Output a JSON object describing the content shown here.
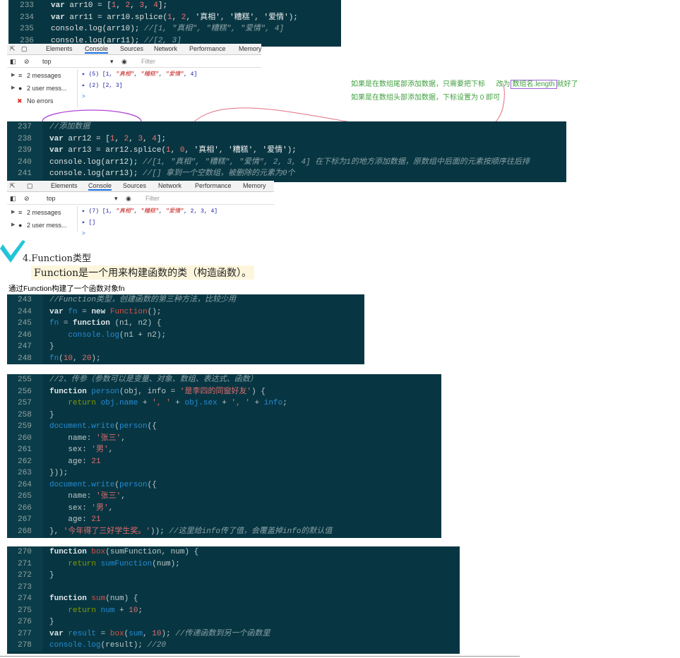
{
  "block1": {
    "lines": [
      {
        "n": "233",
        "html": "<span class='k'>var</span> <span class='p'>arr10 = [</span><span class='n'>1</span><span class='p'>, </span><span class='n'>2</span><span class='p'>, </span><span class='n'>3</span><span class='p'>, </span><span class='n'>4</span><span class='p'>];</span>"
      },
      {
        "n": "234",
        "html": "<span class='k'>var</span> <span class='p'>arr11 = arr10.splice(</span><span class='n'>1</span><span class='p'>, </span><span class='n'>2</span><span class='p'>, </span><span class='s'>'真相'</span><span class='p'>, </span><span class='s'>'糟糕'</span><span class='p'>, </span><span class='s'>'爱情'</span><span class='p'>);</span>"
      },
      {
        "n": "235",
        "html": "<span class='p'>console.log(arr10); </span><span class='c'>//[1, \"真相\", \"糟糕\", \"爱情\", 4]</span>"
      },
      {
        "n": "236",
        "html": "<span class='p'>console.log(arr11); </span><span class='c'>//[2, 3]</span>"
      }
    ]
  },
  "devtools1": {
    "tabs": [
      "Elements",
      "Console",
      "Sources",
      "Network",
      "Performance",
      "Memory"
    ],
    "context": "top",
    "filter_placeholder": "Filter",
    "sidebar": [
      {
        "icon": "≡",
        "label": "2 messages"
      },
      {
        "icon": "●",
        "label": "2 user mess..."
      },
      {
        "icon": "✖",
        "label": "No errors"
      }
    ],
    "output": [
      {
        "prefix": "▸ (5) [1, ",
        "items": [
          "\"真相\"",
          "\"糟糕\"",
          "\"爱情\""
        ],
        "suffix": ", 4]"
      },
      {
        "prefix": "▸ (2) [2, 3]",
        "items": [],
        "suffix": ""
      }
    ],
    "prompt": ">"
  },
  "notes": {
    "line1_a": "如果是在数组尾部添加数据，只需要把下标",
    "line1_b": "改为",
    "line1_box": "数组名.length",
    "line1_c": "就好了",
    "line2": "如果是在数组头部添加数据，下标设置为 0 即可"
  },
  "block2": {
    "lines": [
      {
        "n": "237",
        "html": "<span class='c'>//添加数据</span>"
      },
      {
        "n": "238",
        "html": "<span class='k'>var</span> <span class='p'>arr12 = [</span><span class='n'>1</span><span class='p'>, </span><span class='n'>2</span><span class='p'>, </span><span class='n'>3</span><span class='p'>, </span><span class='n'>4</span><span class='p'>];</span>"
      },
      {
        "n": "239",
        "html": "<span class='k'>var</span> <span class='p'>arr13 = arr12.splice(</span><span class='n'>1</span><span class='p'>, </span><span class='n'>0</span><span class='p'>, </span><span class='s'>'真相'</span><span class='p'>, </span><span class='s'>'糟糕'</span><span class='p'>, </span><span class='s'>'爱情'</span><span class='p'>);</span>"
      },
      {
        "n": "240",
        "html": "<span class='p'>console.log(arr12); </span><span class='c'>//[1, \"真相\", \"糟糕\", \"爱情\", 2, 3, 4] 在下标为1的地方添加数据，原数组中后面的元素按顺序往后排</span>"
      },
      {
        "n": "241",
        "html": "<span class='p'>console.log(arr13); </span><span class='c'>//[] 拿到一个空数组，被删除的元素为0个</span>"
      }
    ]
  },
  "devtools2": {
    "tabs": [
      "Elements",
      "Console",
      "Sources",
      "Network",
      "Performance",
      "Memory"
    ],
    "context": "top",
    "filter_placeholder": "Filter",
    "sidebar": [
      {
        "icon": "≡",
        "label": "2 messages"
      },
      {
        "icon": "●",
        "label": "2 user mess..."
      }
    ],
    "output": [
      {
        "prefix": "▸ (7) [1, ",
        "items": [
          "\"真相\"",
          "\"糟糕\"",
          "\"爱情\""
        ],
        "suffix": ", 2, 3, 4]"
      },
      {
        "prefix": "▸ []",
        "items": [],
        "suffix": ""
      }
    ],
    "prompt": ">"
  },
  "doc": {
    "heading": "4.Function类型",
    "para": "Function是一个用来构建函数的类（构造函数）。",
    "caption": "通过Function构建了一个函数对象fn"
  },
  "block3": {
    "lines": [
      {
        "n": "243",
        "html": "<span class='c'>//Function类型，创建函数的第三种方法，比较少用</span>"
      },
      {
        "n": "244",
        "html": "<span class='kb'>var</span> <span class='f'>fn</span> <span class='pl'>=</span> <span class='kb'>new</span> <span class='fn'>Function</span><span class='pl'>();</span>"
      },
      {
        "n": "245",
        "html": "<span class='f'>fn</span> <span class='pl'>=</span> <span class='kb'>function</span> <span class='pl'>(n1, n2) {</span>"
      },
      {
        "n": "246",
        "html": "    <span class='f'>console.log</span><span class='pl'>(n1 + n2);</span>"
      },
      {
        "n": "247",
        "html": "<span class='pl'>}</span>"
      },
      {
        "n": "248",
        "html": "<span class='f'>fn</span><span class='pl'>(</span><span class='sr'>10</span><span class='pl'>, </span><span class='sr'>20</span><span class='pl'>);</span>"
      }
    ]
  },
  "block4": {
    "lines": [
      {
        "n": "255",
        "html": "<span class='c'>//2、传参（参数可以是变量、对象、数组、表达式、函数）</span>"
      },
      {
        "n": "256",
        "html": "<span class='kb'>function</span> <span class='f'>person</span><span class='pl'>(obj, info = </span><span class='sr'>'是李四的同窗好友'</span><span class='pl'>) {</span>"
      },
      {
        "n": "257",
        "html": "    <span class='kb' style='font-weight:normal;color:#859900'>return</span> <span class='f'>obj.name</span> <span class='pl'>+</span> <span class='sr'>', '</span> <span class='pl'>+</span> <span class='f'>obj.sex</span> <span class='pl'>+</span> <span class='sr'>', '</span> <span class='pl'>+</span> <span class='f'>info</span><span class='pl'>;</span>"
      },
      {
        "n": "258",
        "html": "<span class='pl'>}</span>"
      },
      {
        "n": "259",
        "html": "<span class='f'>document.write</span><span class='pl'>(</span><span class='f'>person</span><span class='pl'>({</span>"
      },
      {
        "n": "260",
        "html": "    <span class='pl'>name: </span><span class='sr'>'张三'</span><span class='pl'>,</span>"
      },
      {
        "n": "261",
        "html": "    <span class='pl'>sex: </span><span class='sr'>'男'</span><span class='pl'>,</span>"
      },
      {
        "n": "262",
        "html": "    <span class='pl'>age: </span><span class='sr'>21</span>"
      },
      {
        "n": "263",
        "html": "<span class='pl'>}));</span>"
      },
      {
        "n": "264",
        "html": "<span class='f'>document.write</span><span class='pl'>(</span><span class='f'>person</span><span class='pl'>({</span>"
      },
      {
        "n": "265",
        "html": "    <span class='pl'>name: </span><span class='sr'>'张三'</span><span class='pl'>,</span>"
      },
      {
        "n": "266",
        "html": "    <span class='pl'>sex: </span><span class='sr'>'男'</span><span class='pl'>,</span>"
      },
      {
        "n": "267",
        "html": "    <span class='pl'>age: </span><span class='sr'>21</span>"
      },
      {
        "n": "268",
        "html": "<span class='pl'>}, </span><span class='sr'>'今年得了三好学生奖。'</span><span class='pl'>)); </span><span class='c'>//这里给info传了值，会覆盖掉info的默认值</span>"
      }
    ]
  },
  "block5": {
    "lines": [
      {
        "n": "270",
        "html": "<span class='kb'>function</span> <span class='fn'>box</span><span class='pl'>(sumFunction, num) {</span>"
      },
      {
        "n": "271",
        "html": "    <span style='color:#859900'>return</span> <span class='f'>sumFunction</span><span class='pl'>(num);</span>"
      },
      {
        "n": "272",
        "html": "<span class='pl'>}</span>"
      },
      {
        "n": "273",
        "html": ""
      },
      {
        "n": "274",
        "html": "<span class='kb'>function</span> <span class='fn'>sum</span><span class='pl'>(num) {</span>"
      },
      {
        "n": "275",
        "html": "    <span style='color:#859900'>return</span> <span class='f'>num</span> <span class='pl'>+</span> <span class='sr'>10</span><span class='pl'>;</span>"
      },
      {
        "n": "276",
        "html": "<span class='pl'>}</span>"
      },
      {
        "n": "277",
        "html": "<span class='kb'>var</span> <span class='f'>result</span> <span class='pl'>=</span> <span class='fn'>box</span><span class='pl'>(</span><span class='f'>sum</span><span class='pl'>, </span><span class='sr'>10</span><span class='pl'>); </span><span class='c'>//传递函数到另一个函数里</span>"
      },
      {
        "n": "278",
        "html": "<span class='f'>console.log</span><span class='pl'>(result); </span><span class='c'>//20</span>"
      }
    ]
  }
}
